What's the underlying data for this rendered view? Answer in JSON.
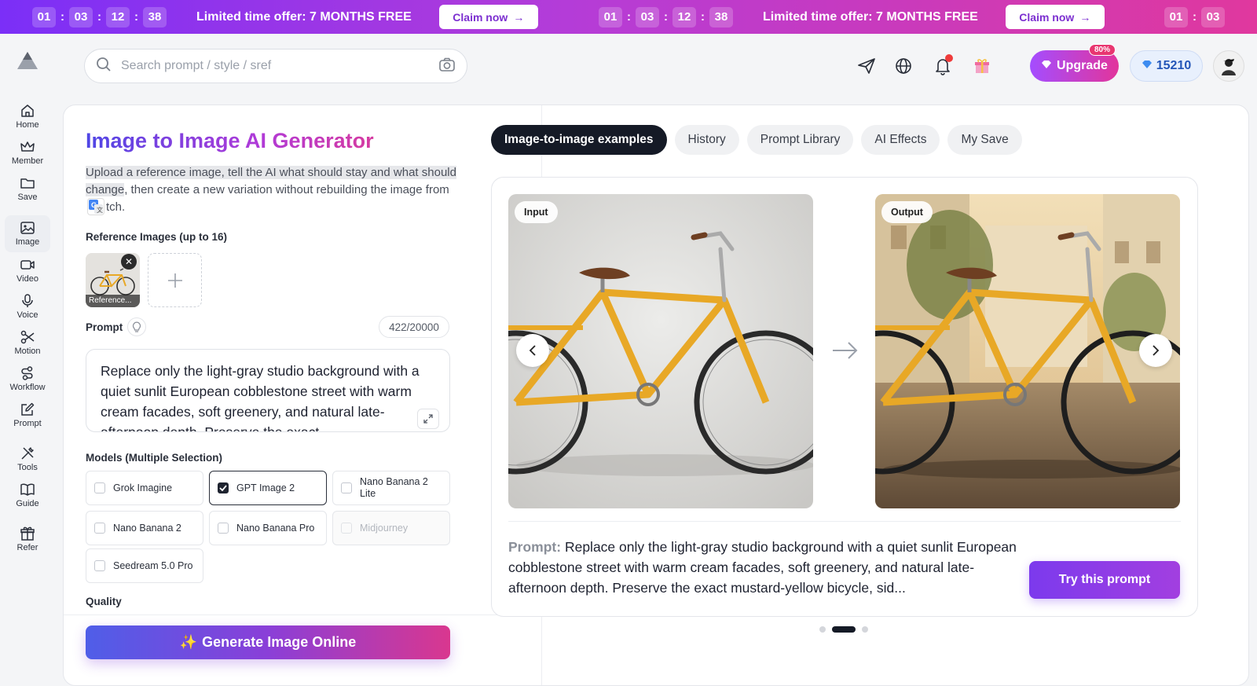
{
  "promo": {
    "countdown": [
      "01",
      "03",
      "12",
      "38"
    ],
    "text_prefix": "Limited time offer: ",
    "text_bold": "7 MONTHS FREE",
    "claim_label": "Claim now"
  },
  "search": {
    "placeholder": "Search prompt / style / sref"
  },
  "header": {
    "upgrade_label": "Upgrade",
    "upgrade_badge": "80%",
    "credits": "15210"
  },
  "sidebar": {
    "items": [
      {
        "label": "Home",
        "icon": "home-icon"
      },
      {
        "label": "Member",
        "icon": "crown-icon"
      },
      {
        "label": "Save",
        "icon": "folder-icon"
      },
      {
        "label": "Image",
        "icon": "image-icon"
      },
      {
        "label": "Video",
        "icon": "video-icon"
      },
      {
        "label": "Voice",
        "icon": "microphone-icon"
      },
      {
        "label": "Motion",
        "icon": "motion-icon"
      },
      {
        "label": "Workflow",
        "icon": "workflow-icon"
      },
      {
        "label": "Prompt",
        "icon": "edit-icon"
      },
      {
        "label": "Tools",
        "icon": "tools-icon"
      },
      {
        "label": "Guide",
        "icon": "book-icon"
      },
      {
        "label": "Refer",
        "icon": "gift-icon"
      }
    ]
  },
  "left": {
    "title": "Image to Image AI Generator",
    "desc_highlight": "Upload a reference image, tell the AI what should stay and what should change",
    "desc_rest_a": ", then create a new variation without rebuilding the image from ",
    "desc_rest_b": "tch.",
    "ref_label": "Reference Images (up to 16)",
    "ref_caption": "Reference...",
    "prompt_label": "Prompt",
    "prompt_counter": "422/20000",
    "prompt_text": "Replace only the light-gray studio background with a quiet sunlit European cobblestone street with warm cream facades, soft greenery, and natural late-afternoon depth. Preserve the exact",
    "models_label": "Models (Multiple Selection)",
    "models": [
      {
        "name": "Grok Imagine",
        "checked": false,
        "disabled": false
      },
      {
        "name": "GPT Image 2",
        "checked": true,
        "disabled": false
      },
      {
        "name": "Nano Banana 2 Lite",
        "checked": false,
        "disabled": false
      },
      {
        "name": "Nano Banana 2",
        "checked": false,
        "disabled": false
      },
      {
        "name": "Nano Banana Pro",
        "checked": false,
        "disabled": false
      },
      {
        "name": "Midjourney",
        "checked": false,
        "disabled": true
      },
      {
        "name": "Seedream 5.0 Pro",
        "checked": false,
        "disabled": false
      }
    ],
    "quality_label": "Quality",
    "generate_label": "Generate Image Online"
  },
  "right": {
    "tabs": [
      "Image-to-image examples",
      "History",
      "Prompt Library",
      "AI Effects",
      "My Save"
    ],
    "active_tab": 0,
    "input_tag": "Input",
    "output_tag": "Output",
    "prompt_label": "Prompt:",
    "prompt_text": "Replace only the light-gray studio background with a quiet sunlit European cobblestone street with warm cream facades, soft greenery, and natural late-afternoon depth. Preserve the exact mustard-yellow bicycle, sid...",
    "try_label": "Try this prompt",
    "pagination": {
      "count": 3,
      "active": 1
    }
  },
  "colors": {
    "brand_purple": "#7c3aed",
    "promo_start": "#7b2ff7",
    "promo_end": "#e0389e",
    "bike_yellow": "#e8a826"
  }
}
